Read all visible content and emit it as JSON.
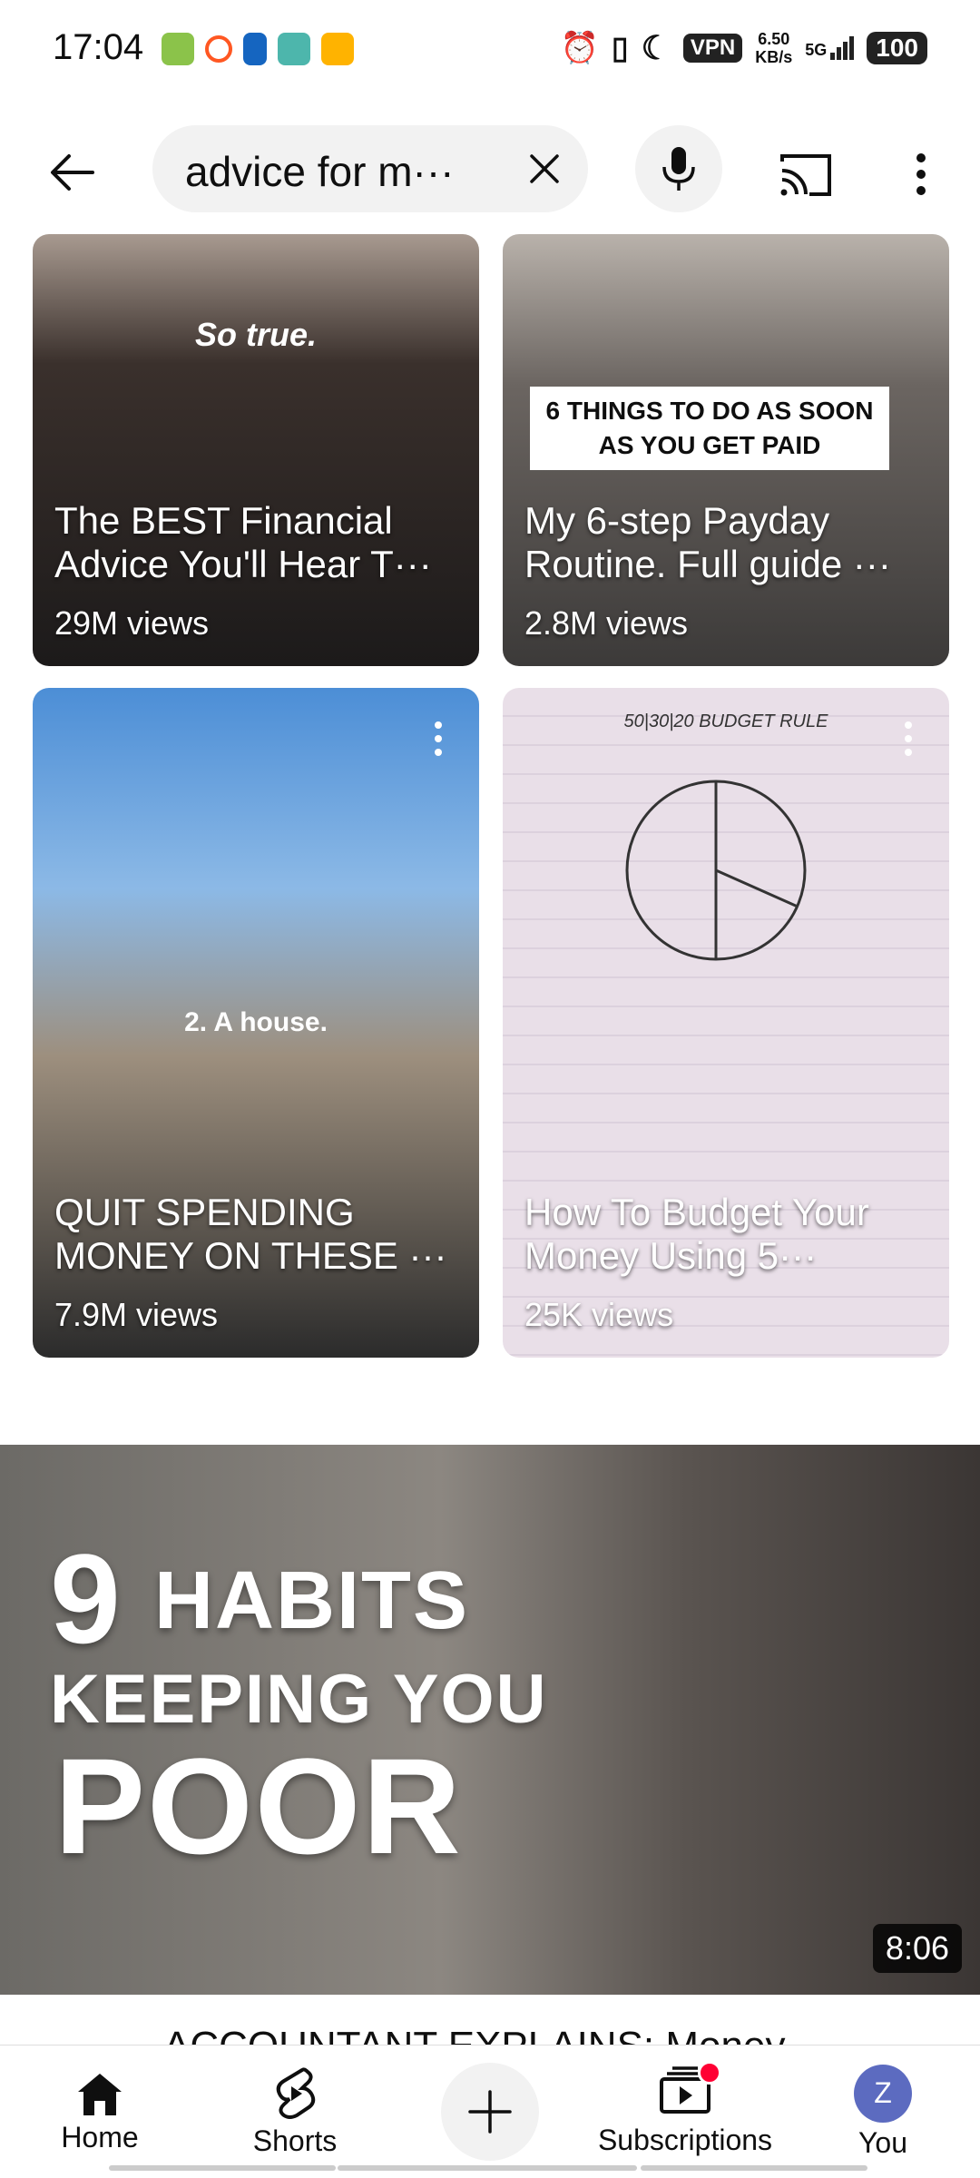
{
  "status_bar": {
    "time": "17:04",
    "vpn": "VPN",
    "net_speed": "6.50",
    "net_unit": "KB/s",
    "network": "5G",
    "battery": "100"
  },
  "search": {
    "query": "advice for m···"
  },
  "shorts": [
    {
      "overlay": "So true.",
      "title": "The BEST Financial Advice You'll Hear T···",
      "views": "29M views"
    },
    {
      "overlay": "6 THINGS TO DO AS SOON AS YOU GET PAID",
      "title": "My 6-step Payday Routine. Full guide ···",
      "views": "2.8M views"
    },
    {
      "overlay": "2. A house.",
      "title": "QUIT SPENDING MONEY ON THESE ···",
      "views": "7.9M views"
    },
    {
      "overlay": "50|30|20 BUDGET RULE",
      "title": "How To Budget Your Money Using 5···",
      "views": "25K views"
    }
  ],
  "video": {
    "thumb_line1_num": "9",
    "thumb_line1": "HABITS",
    "thumb_line2": "KEEPING YOU",
    "thumb_line3": "POOR",
    "duration": "8:06",
    "title": "ACCOUNTANT EXPLAINS: Money"
  },
  "nav": {
    "home": "Home",
    "shorts": "Shorts",
    "subscriptions": "Subscriptions",
    "you": "You",
    "avatar_letter": "Z"
  },
  "colors": {
    "accent_red": "#ff0033",
    "avatar_bg": "#5c6bc0"
  }
}
